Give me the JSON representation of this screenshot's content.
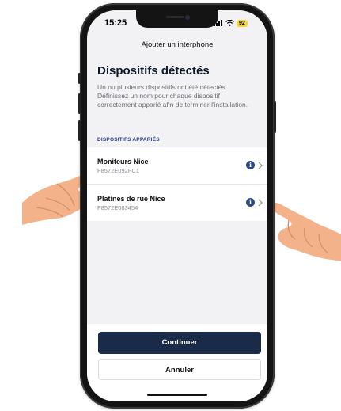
{
  "status": {
    "time": "15:25",
    "battery": "92"
  },
  "nav": {
    "title": "Ajouter un interphone"
  },
  "page": {
    "title": "Dispositifs détectés",
    "description": "Un ou plusieurs dispositifs ont été détectés. Définissez un nom pour chaque dispositif correctement apparié afin de terminer l'installation."
  },
  "section": {
    "title": "DISPOSITIFS APPARIÉS"
  },
  "devices": [
    {
      "name": "Moniteurs Nice",
      "id": "F8572E092FC1"
    },
    {
      "name": "Platines de rue Nice",
      "id": "F8572E083454"
    }
  ],
  "actions": {
    "continue": "Continuer",
    "cancel": "Annuler"
  },
  "colors": {
    "accent": "#1a2b4a",
    "section": "#2b3f86",
    "battery": "#f5d63c"
  }
}
